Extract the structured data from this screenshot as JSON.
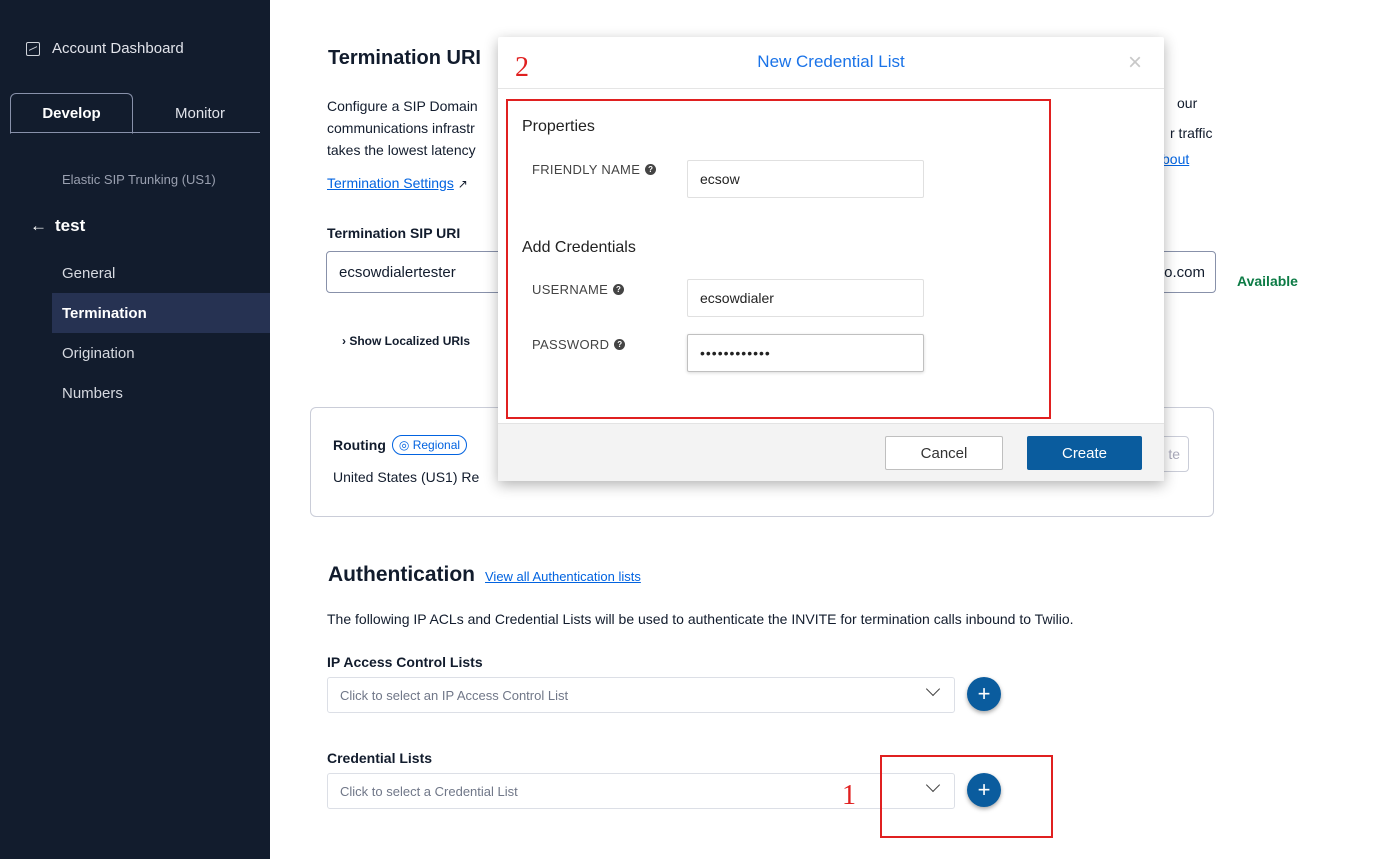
{
  "sidebar": {
    "dashboard": "Account Dashboard",
    "tabs": [
      "Develop",
      "Monitor"
    ],
    "product": "Elastic SIP Trunking (US1)",
    "trunk_name": "test",
    "nav": [
      "General",
      "Termination",
      "Origination",
      "Numbers"
    ],
    "active_nav": "Termination"
  },
  "termination": {
    "title": "Termination URI",
    "desc_line1": "Configure a SIP Domain",
    "desc_line2": "communications infrastr",
    "desc_line3": "takes the lowest latency",
    "desc_right1": "our",
    "desc_right2": "r traffic",
    "desc_right3": "bout",
    "settings_link": "Termination Settings",
    "sip_uri_label": "Termination SIP URI",
    "sip_uri_value": "ecsowdialertester",
    "sip_uri_suffix": "o.com",
    "availability": "Available",
    "show_localized": "Show Localized URIs"
  },
  "routing": {
    "title": "Routing",
    "badge": "Regional",
    "text": "United States (US1) Re",
    "button_fragment": "te"
  },
  "authentication": {
    "title": "Authentication",
    "view_link": "View all Authentication lists",
    "description": "The following IP ACLs and Credential Lists will be used to authenticate the INVITE for termination calls inbound to Twilio.",
    "ip_acl_label": "IP Access Control Lists",
    "ip_acl_placeholder": "Click to select an IP Access Control List",
    "cred_label": "Credential Lists",
    "cred_placeholder": "Click to select a Credential List"
  },
  "modal": {
    "title": "New Credential List",
    "close": "×",
    "properties_heading": "Properties",
    "friendly_name_label": "FRIENDLY NAME",
    "friendly_name_value": "ecsow",
    "add_credentials_heading": "Add Credentials",
    "username_label": "USERNAME",
    "username_value": "ecsowdialer",
    "password_label": "PASSWORD",
    "password_value": "••••••••••••",
    "cancel_label": "Cancel",
    "create_label": "Create"
  },
  "annotations": {
    "one": "1",
    "two": "2",
    "color": "#e02020"
  },
  "colors": {
    "sidebar_bg": "#121c2d",
    "primary_button": "#0a5c9e",
    "available": "#0c7b45",
    "link": "#0263e0"
  }
}
